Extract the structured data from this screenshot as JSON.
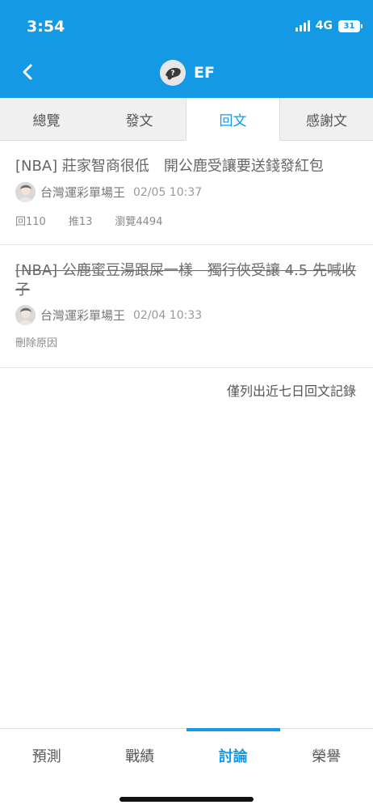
{
  "status_bar": {
    "time": "3:54",
    "network": "4G",
    "battery": "31"
  },
  "header": {
    "user_name": "EF",
    "back_icon": "chevron-left-icon"
  },
  "tabs": [
    {
      "label": "總覽"
    },
    {
      "label": "發文"
    },
    {
      "label": "回文",
      "active": true
    },
    {
      "label": "感謝文"
    }
  ],
  "posts": [
    {
      "title": "[NBA] 莊家智商很低　開公鹿受讓要送錢發紅包",
      "author": "台灣運彩單場王",
      "time": "02/05 10:37",
      "replies": "回110",
      "likes": "推13",
      "views": "瀏覽4494",
      "deleted": false
    },
    {
      "title": "[NBA] 公鹿蜜豆湯跟屎一樣　獨行俠受讓 4.5 先喊收子",
      "author": "台灣運彩單場王",
      "time": "02/04 10:33",
      "delete_reason": "刪除原因",
      "deleted": true
    }
  ],
  "footnote": "僅列出近七日回文記錄",
  "bottom_nav": [
    {
      "label": "預測"
    },
    {
      "label": "戰績"
    },
    {
      "label": "討論",
      "active": true
    },
    {
      "label": "榮譽"
    }
  ],
  "colors": {
    "accent": "#1499e4",
    "text": "#666666"
  }
}
